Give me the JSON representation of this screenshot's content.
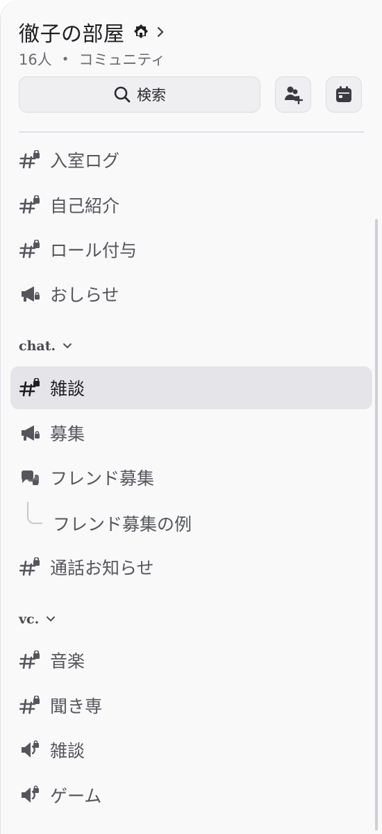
{
  "server": {
    "name": "徹子の部屋",
    "members": "16人",
    "type": "コミュニティ"
  },
  "search": {
    "label": "検索"
  },
  "channels_top": [
    {
      "label": "入室ログ",
      "icon": "locked-hash-icon"
    },
    {
      "label": "自己紹介",
      "icon": "locked-hash-icon"
    },
    {
      "label": "ロール付与",
      "icon": "locked-hash-icon"
    },
    {
      "label": "おしらせ",
      "icon": "megaphone-icon"
    }
  ],
  "category_chat": {
    "label": "chat."
  },
  "channels_chat": [
    {
      "label": "雑談",
      "icon": "locked-hash-icon",
      "active": true
    },
    {
      "label": "募集",
      "icon": "megaphone-icon"
    },
    {
      "label": "フレンド募集",
      "icon": "forum-icon"
    },
    {
      "label": "通話お知らせ",
      "icon": "locked-hash-icon"
    }
  ],
  "thread": {
    "label": "フレンド募集の例"
  },
  "category_vc": {
    "label": "vc."
  },
  "channels_vc": [
    {
      "label": "音楽",
      "icon": "locked-hash-icon"
    },
    {
      "label": "聞き専",
      "icon": "locked-hash-icon"
    },
    {
      "label": "雑談",
      "icon": "locked-speaker-icon"
    },
    {
      "label": "ゲーム",
      "icon": "locked-speaker-icon"
    }
  ]
}
